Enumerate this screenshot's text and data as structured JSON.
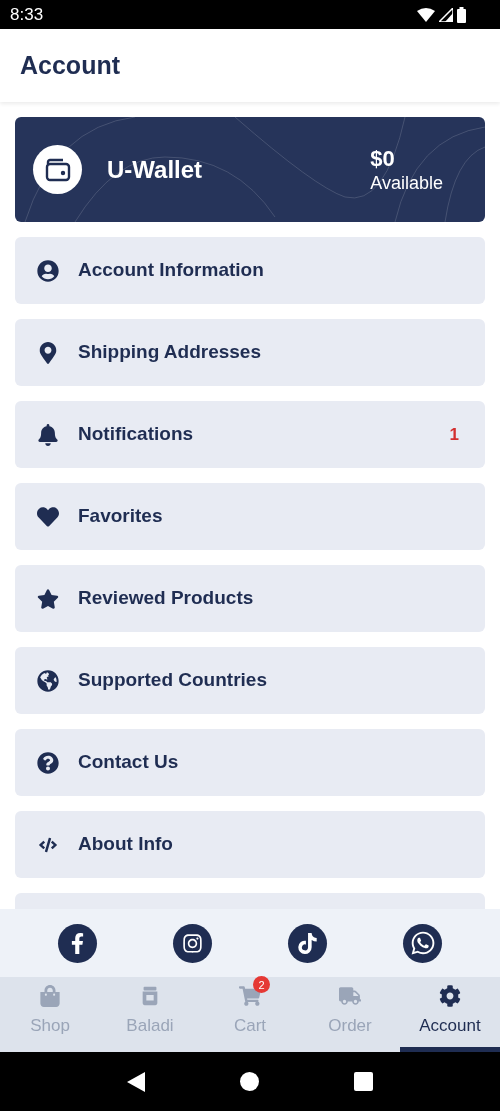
{
  "status_bar": {
    "time": "8:33"
  },
  "header": {
    "title": "Account"
  },
  "wallet": {
    "title": "U-Wallet",
    "amount": "$0",
    "caption": "Available"
  },
  "menu": [
    {
      "label": "Account Information"
    },
    {
      "label": "Shipping Addresses"
    },
    {
      "label": "Notifications",
      "badge": "1"
    },
    {
      "label": "Favorites"
    },
    {
      "label": "Reviewed Products"
    },
    {
      "label": "Supported Countries"
    },
    {
      "label": "Contact Us"
    },
    {
      "label": "About Info"
    }
  ],
  "tabs": [
    {
      "label": "Shop",
      "selected": false
    },
    {
      "label": "Baladi",
      "selected": false
    },
    {
      "label": "Cart",
      "selected": false,
      "badge": "2"
    },
    {
      "label": "Order",
      "selected": false
    },
    {
      "label": "Account",
      "selected": true
    }
  ]
}
